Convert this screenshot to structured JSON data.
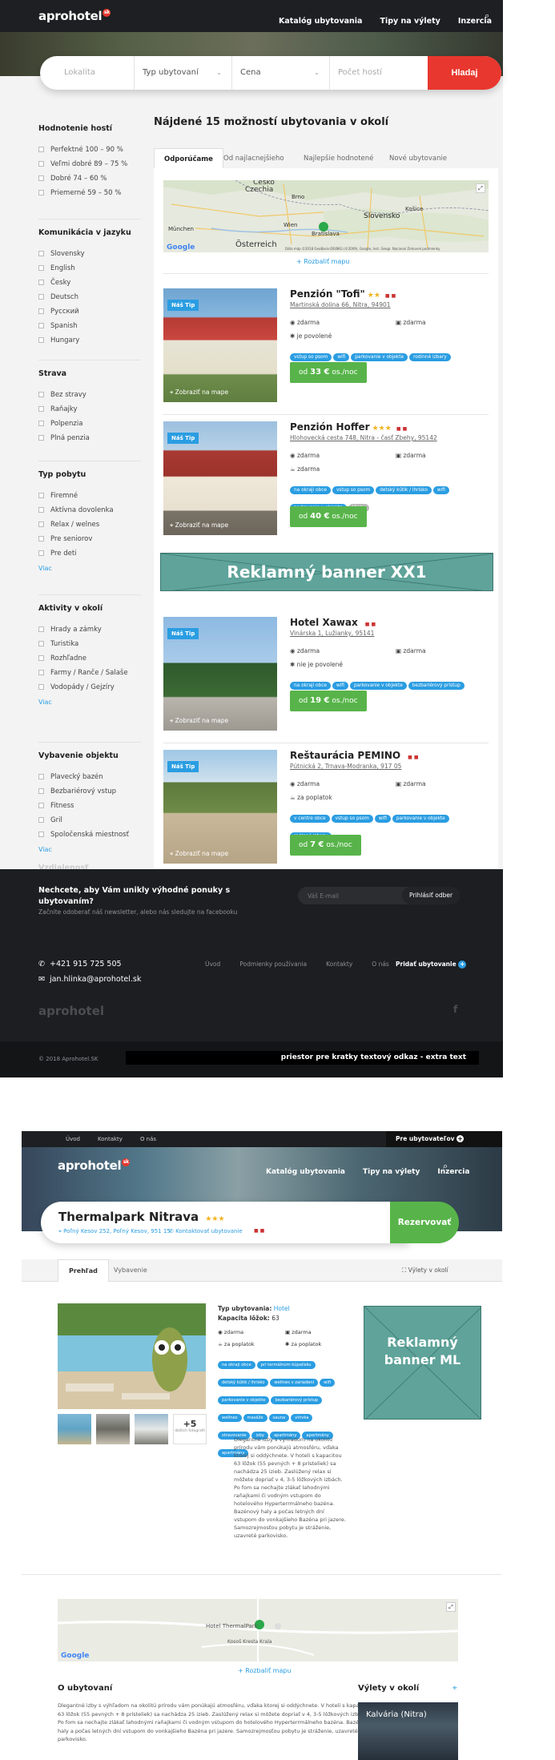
{
  "header": {
    "logo": "aprohotel",
    "logo_badge": "sk",
    "nav": [
      "Katalóg ubytovania",
      "Tipy na výlety",
      "Inzercia"
    ]
  },
  "search": {
    "lokalita": "Lokalita",
    "typ": "Typ ubytovaní",
    "cena": "Cena",
    "hostia": "Počet hostí",
    "button": "Hladaj"
  },
  "filters": {
    "groups": [
      {
        "title": "Hodnotenie hostí",
        "options": [
          "Perfektné 100 – 90 %",
          "Veľmi dobré 89 – 75 %",
          "Dobré 74 – 60 %",
          "Priemerné 59 – 50 %"
        ]
      },
      {
        "title": "Komunikácia v jazyku",
        "options": [
          "Slovensky",
          "English",
          "Česky",
          "Deutsch",
          "Русский",
          "Spanish",
          "Hungary"
        ]
      },
      {
        "title": "Strava",
        "options": [
          "Bez stravy",
          "Raňajky",
          "Polpenzia",
          "Plná penzia"
        ]
      },
      {
        "title": "Typ pobytu",
        "options": [
          "Firemné",
          "Aktívna dovolenka",
          "Relax / welnes",
          "Pre seniorov",
          "Pre deti"
        ],
        "more": "Viac"
      },
      {
        "title": "Aktivity v okolí",
        "options": [
          "Hrady a zámky",
          "Turistika",
          "Rozhľadne",
          "Farmy / Ranče / Salaše",
          "Vodopády / Gejzíry"
        ],
        "more": "Viac"
      },
      {
        "title": "Vybavenie objektu",
        "options": [
          "Plavecký bazén",
          "Bezbariérový vstup",
          "Fitness",
          "Gril",
          "Spoločenská miestnosť"
        ],
        "more": "Viac"
      }
    ],
    "partial": "Vzdialenosť"
  },
  "results": {
    "title": "Nájdené 15 možností ubytovania v okolí",
    "tabs": [
      "Odporúčame",
      "Od najlacnejšieho",
      "Najlepšie hodnotené",
      "Nové ubytovanie"
    ],
    "expand_map": "+ Rozbaliť mapu",
    "map_labels": [
      "Česko",
      "Czechia",
      "Brno",
      "Slovensko",
      "Košice",
      "Wien",
      "Bratislava",
      "München",
      "Österreich"
    ],
    "map_footer": "Dáta máp ©2018 GeoBasis-DE/BKG (©2009), Google, Inst. Geogr. Nacional   Zmluvné podmienky",
    "map_brand": "Google",
    "cards": [
      {
        "name": "Penzión \"Tofi\"",
        "stars": "★★",
        "flags": "■ ■",
        "address": "Martinská dolina 66, Nitra, 94901",
        "badge": "Náš Tip",
        "show_map": "Zobraziť na mape",
        "a1": "zdarma",
        "a2": "zdarma",
        "a3": "je povolené",
        "tags": [
          "vstup so psom",
          "wifi",
          "parkovanie v objekte",
          "rodinné izbary"
        ],
        "price_pre": "od",
        "price": "33 €",
        "price_post": "os./noc"
      },
      {
        "name": "Penzión Hoffer",
        "stars": "★★★",
        "flags": "■ ■",
        "address": "Hlohovecká cesta 748, Nitra - časť Zbehy, 95142",
        "badge": "Náš Tip",
        "show_map": "Zobraziť na mape",
        "a1": "zdarma",
        "a2": "zdarma",
        "a3": "zdarma",
        "tags": [
          "na okraji obce",
          "vstup so psom",
          "detský kútik / ihrisko",
          "wifi",
          "parkovanie v objekte"
        ],
        "tag_more": "Viac..",
        "price_pre": "od",
        "price": "40 €",
        "price_post": "os./noc"
      },
      {
        "name": "Hotel Xawax",
        "stars": "",
        "flags": "■ ■",
        "address": "Vinárska 1, Lužianky, 95141",
        "badge": "Náš Tip",
        "show_map": "Zobraziť na mape",
        "a1": "zdarma",
        "a2": "zdarma",
        "a3": "nie je povolené",
        "tags": [
          "na okraji obce",
          "wifi",
          "parkovanie v objekte",
          "bezbariérový prístup"
        ],
        "price_pre": "od",
        "price": "19 €",
        "price_post": "os./noc"
      },
      {
        "name": "Reštaurácia PEMINO",
        "stars": "",
        "flags": "■ ■",
        "address": "Pútnická 2, Trnava-Modranka, 917 05",
        "badge": "Náš Tip",
        "show_map": "Zobraziť na mape",
        "a1": "zdarma",
        "a2": "zdarma",
        "a3": "za poplatok",
        "tags": [
          "v centre obce",
          "vstup so psom",
          "wifi",
          "parkovanie v objekte",
          "rodinné izbary"
        ],
        "price_pre": "od",
        "price": "7 €",
        "price_post": "os./noc"
      }
    ],
    "banner": "Reklamný banner XX1"
  },
  "footer": {
    "news_title": "Nechcete, aby Vám unikly výhodné ponuky s ubytovaním?",
    "news_sub": "Začnite odoberať náš newsletter, alebo nás sledujte na facebooku",
    "email_ph": "Váš E-mail",
    "subscribe": "Prihlásiť odber",
    "phone": "+421 915 725 505",
    "email": "jan.hlinka@aprohotel.sk",
    "links": [
      "Úvod",
      "Podmienky používania",
      "Kontakty",
      "O nás"
    ],
    "add": "Pridať ubytovanie",
    "logo": "aprohotel",
    "copyright": "© 2018 Aprohotel.SK",
    "textlink": "priestor pre kratky textový odkaz - extra text"
  },
  "detail": {
    "top_links": [
      "Úvod",
      "Kontakty",
      "O nás"
    ],
    "for_owners": "Pre ubytovateľov",
    "nav": [
      "Katalóg ubytovania",
      "Tipy na výlety",
      "Inzercia"
    ],
    "name": "Thermalpark Nitrava",
    "stars": "★★★",
    "address": "Poľný Kesov 252, Poľný Kesov, 951 15",
    "contact": "Kontaktovať ubytovanie",
    "flags": "■ ■",
    "reserve": "Rezervovať",
    "tabs": [
      "Prehľad",
      "Vybavenie"
    ],
    "trips": "Výlety v okolí",
    "type_label": "Typ ubytovania:",
    "type_value": "Hotel",
    "capacity_label": "Kapacita lôžok:",
    "capacity_value": "63",
    "a1": "zdarma",
    "a2": "zdarma",
    "a3": "za poplatok",
    "a4": "za poplatok",
    "tags": [
      "na okraji obce",
      "pri termálnom kúpalisku",
      "detský kútik / ihrisko",
      "wellnes v zariadení",
      "wifi",
      "parkovanie v objekte",
      "bezbariérový prístup",
      "wellnes",
      "masáže",
      "sauna",
      "vírivka",
      "stravovanie",
      "izby",
      "apartmány",
      "apartmány",
      "apartmány"
    ],
    "more_photos": "+5",
    "more_photos_sub": "ďalších fotografií",
    "description": "Dlegantné izby s výhľadom na okolitú prírodu vám ponúkajú atmosféru, vďaka ktorej si oddýchnete. V hoteli s kapacitou 63 lôžok (55 pevných + 8 prísteliek) sa nachádza 25 izieb. Zaslúžený relax si môžete dopriať v 4, 3-5 lôžkových izbách. Po fom sa nechajte zlákať lahodnými raňajkami či vodným vstupom do hotelového Hyperterrmálneho bazéna. Bazénový haly a počas letných dní vstupom do vonkajšieho Bazéna pri jazere. Samozrejmosťou pobytu je stráženie, uzavreté parkovisko.",
    "banner": "Reklamný banner ML",
    "map_labels": [
      "Hotel ThermalPark",
      "Kosoš Kresta Krala"
    ],
    "map_brand": "Google",
    "expand_map": "+ Rozbaliť mapu",
    "about_title": "O ubytovaní",
    "about_text": "Dlegantné izby s výhľadom na okolitú prírodu vám ponúkajú atmosféru, vďaka ktorej si oddýchnete. V hoteli s kapacitou 63 lôžok (55 pevných + 8 prísteliek) sa nachádza 25 izieb. Zaslúžený relax si môžete dopriať v 4, 3-5 lôžkových izbách. Po fom sa nechajte zlákať lahodnými raňajkami či vodným vstupom do hotelového Hyperterrmálneho bazéna. Bazénový haly a počas letných dní vstupom do vonkajšieho Bazéna pri jazere. Samozrejmosťou pobytu je stráženie, uzavreté parkovisko.",
    "trips_title": "Výlety v okolí",
    "trip1": "Kalvária (Nitra)"
  },
  "colors": {
    "accent": "#e8372e",
    "blue": "#2a9de2",
    "green": "#58b44a",
    "dark": "#1d1f22"
  }
}
